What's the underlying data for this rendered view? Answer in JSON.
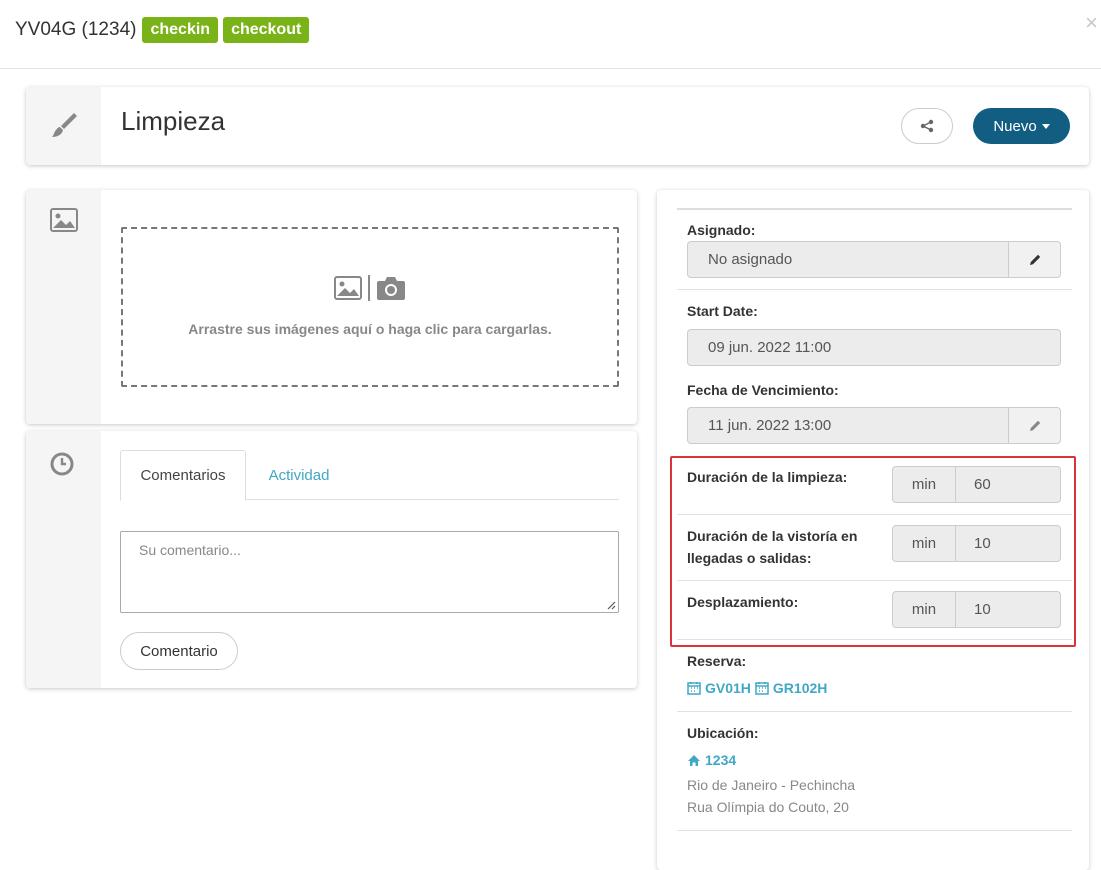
{
  "header": {
    "title": "YV04G (1234)",
    "badges": [
      "checkin",
      "checkout"
    ],
    "close": "×"
  },
  "task": {
    "title": "Limpieza",
    "share_icon": "share-icon",
    "new_button": "Nuevo"
  },
  "upload": {
    "text": "Arrastre sus imágenes aquí o haga clic para cargarlas."
  },
  "comments": {
    "tabs": [
      "Comentarios",
      "Actividad"
    ],
    "placeholder": "Su comentario...",
    "button": "Comentario"
  },
  "details": {
    "assigned": {
      "label": "Asignado:",
      "value": "No asignado"
    },
    "start_date": {
      "label": "Start Date:",
      "value": "09 jun. 2022 11:00"
    },
    "due_date": {
      "label": "Fecha de Vencimiento:",
      "value": "11 jun. 2022 13:00"
    },
    "durations": [
      {
        "label": "Duración de la limpieza:",
        "unit": "min",
        "value": "60"
      },
      {
        "label": "Duración de la vistoría en llegadas o salidas:",
        "unit": "min",
        "value": "10"
      },
      {
        "label": "Desplazamiento:",
        "unit": "min",
        "value": "10"
      }
    ],
    "reservation": {
      "label": "Reserva:",
      "links": [
        "GV01H",
        "GR102H"
      ]
    },
    "location": {
      "label": "Ubicación:",
      "link": "1234",
      "line1": "Rio de Janeiro - Pechincha",
      "line2": "Rua Olímpia do Couto, 20"
    }
  },
  "colors": {
    "badge": "#7ab317",
    "primary_button": "#115e82",
    "link": "#3fa8c5",
    "highlight": "#d9343e"
  }
}
